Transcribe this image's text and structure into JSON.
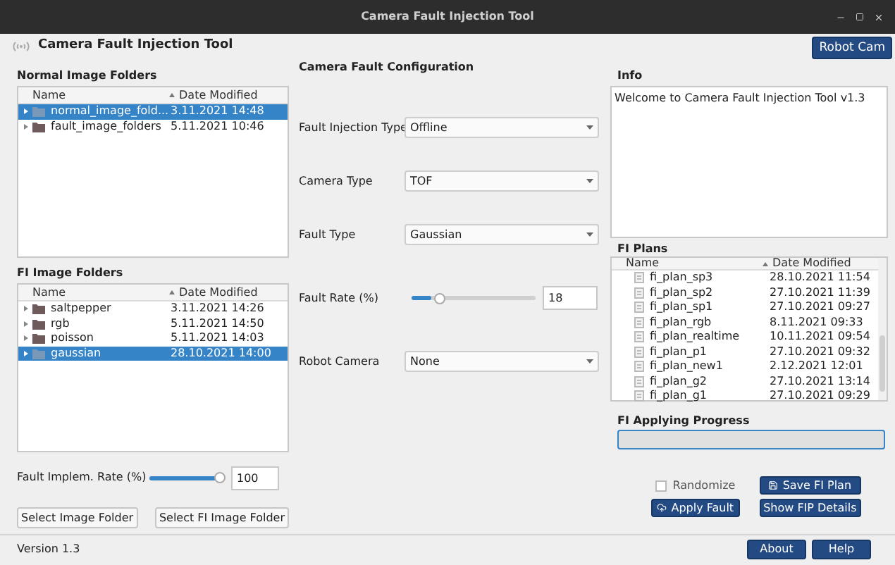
{
  "window": {
    "title": "Camera Fault Injection Tool"
  },
  "app_title": "Camera Fault Injection Tool",
  "robot_cam_button": "Robot Cam",
  "normal_folders": {
    "label": "Normal Image Folders",
    "columns": [
      "Name",
      "Date Modified"
    ],
    "rows": [
      {
        "name": "normal_image_fold...",
        "date": "3.11.2021 14:48",
        "selected": true
      },
      {
        "name": "fault_image_folders",
        "date": "5.11.2021 10:46",
        "selected": false
      }
    ]
  },
  "fi_folders": {
    "label": "FI Image Folders",
    "columns": [
      "Name",
      "Date Modified"
    ],
    "rows": [
      {
        "name": "saltpepper",
        "date": "3.11.2021 14:26",
        "selected": false
      },
      {
        "name": "rgb",
        "date": "5.11.2021 14:50",
        "selected": false
      },
      {
        "name": "poisson",
        "date": "5.11.2021 14:03",
        "selected": false
      },
      {
        "name": "gaussian",
        "date": "28.10.2021 14:00",
        "selected": true
      }
    ]
  },
  "implem_rate": {
    "label": "Fault Implem. Rate (%)",
    "level": 1,
    "value": "100"
  },
  "left_buttons": [
    "Select Image Folder",
    "Select FI Image Folder"
  ],
  "config": {
    "title": "Camera Fault Configuration",
    "fields": [
      {
        "kind": "dropdown",
        "label": "Fault Injection Type",
        "value": "Offline"
      },
      {
        "kind": "dropdown",
        "label": "Camera Type",
        "value": "TOF"
      },
      {
        "kind": "dropdown",
        "label": "Fault Type",
        "value": "Gaussian"
      },
      {
        "kind": "slider",
        "label": "Fault Rate (%)",
        "level": 0.2,
        "value": "18"
      },
      {
        "kind": "dropdown",
        "label": "Robot Camera",
        "value": "None"
      }
    ]
  },
  "info": {
    "label": "Info",
    "text": "Welcome to Camera Fault Injection Tool v1.3"
  },
  "fi_plans": {
    "label": "FI Plans",
    "columns": [
      "Name",
      "Date Modified"
    ],
    "rows": [
      {
        "name": "fi_plan_sp3",
        "date": "28.10.2021 11:54"
      },
      {
        "name": "fi_plan_sp2",
        "date": "27.10.2021 11:39"
      },
      {
        "name": "fi_plan_sp1",
        "date": "27.10.2021 09:27"
      },
      {
        "name": "fi_plan_rgb",
        "date": "8.11.2021 09:33"
      },
      {
        "name": "fi_plan_realtime",
        "date": "10.11.2021 09:54"
      },
      {
        "name": "fi_plan_p1",
        "date": "27.10.2021 09:32"
      },
      {
        "name": "fi_plan_new1",
        "date": "2.12.2021 12:01"
      },
      {
        "name": "fi_plan_g2",
        "date": "27.10.2021 13:14"
      },
      {
        "name": "fi_plan_g1",
        "date": "27.10.2021 09:29"
      }
    ]
  },
  "progress": {
    "label": "FI Applying Progress"
  },
  "randomize": {
    "label": "Randomize",
    "checked": false
  },
  "save_plan_button": "Save FI Plan",
  "apply_fault_button": "Apply Fault",
  "show_details_button": "Show FIP Details",
  "status": {
    "version": "Version 1.3"
  },
  "footer_buttons": [
    "About",
    "Help"
  ]
}
